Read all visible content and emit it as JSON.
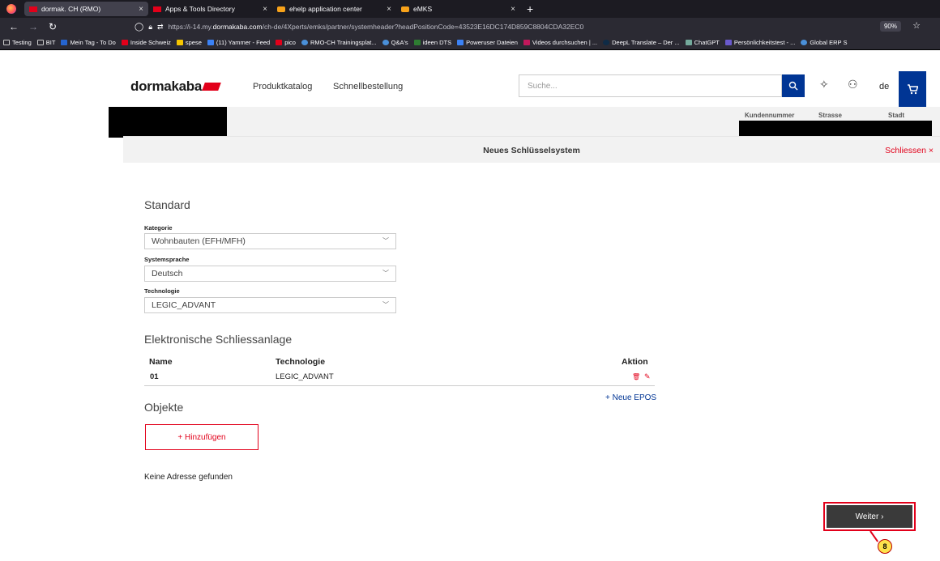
{
  "browser": {
    "tabs": [
      {
        "label": "dormak. CH (RMO)"
      },
      {
        "label": "Apps & Tools Directory"
      },
      {
        "label": "ehelp application center"
      },
      {
        "label": "eMKS"
      }
    ],
    "new_tab": "+",
    "url_prefix": "https://i-14.my.",
    "url_host": "dormakaba.com",
    "url_path": "/ch-de/4Xperts/emks/partner/systemheader?headPositionCode=43523E16DC174D859C8804CDA32EC0",
    "zoom": "90%",
    "bookmarks": [
      "Testing",
      "BIT",
      "Mein Tag - To Do",
      "Inside Schweiz",
      "spese",
      "(11) Yammer - Feed",
      "pico",
      "RMO-CH Trainingsplat...",
      "Q&A's",
      "ideen DTS",
      "Poweruser Dateien",
      "Videos durchsuchen | ...",
      "DeepL Translate – Der ...",
      "ChatGPT",
      "Persönlichkeitstest - ...",
      "Global ERP S"
    ]
  },
  "header": {
    "logo": "dormakaba",
    "nav": [
      "Produktkatalog",
      "Schnellbestellung"
    ],
    "search_placeholder": "Suche...",
    "lang": "de"
  },
  "customer": {
    "cols": [
      "Kundennummer",
      "Strasse",
      "Stadt"
    ]
  },
  "titlebar": {
    "title": "Neues Schlüsselsystem",
    "close": "Schliessen ×"
  },
  "form": {
    "standard_heading": "Standard",
    "kategorie_label": "Kategorie",
    "kategorie_value": "Wohnbauten (EFH/MFH)",
    "sprache_label": "Systemsprache",
    "sprache_value": "Deutsch",
    "technologie_label": "Technologie",
    "technologie_value": "LEGIC_ADVANT"
  },
  "elektronisch": {
    "heading": "Elektronische Schliessanlage",
    "headers": {
      "name": "Name",
      "tech": "Technologie",
      "aktion": "Aktion"
    },
    "rows": [
      {
        "name": "01",
        "tech": "LEGIC_ADVANT"
      }
    ],
    "neue_epos": "+ Neue EPOS"
  },
  "objekte": {
    "heading": "Objekte",
    "add_button": "+ Hinzufügen",
    "empty": "Keine Adresse gefunden"
  },
  "footer": {
    "next_button": "Weiter ›",
    "callout": "8"
  },
  "colors": {
    "brand_red": "#e2001a",
    "brand_blue": "#003594"
  }
}
